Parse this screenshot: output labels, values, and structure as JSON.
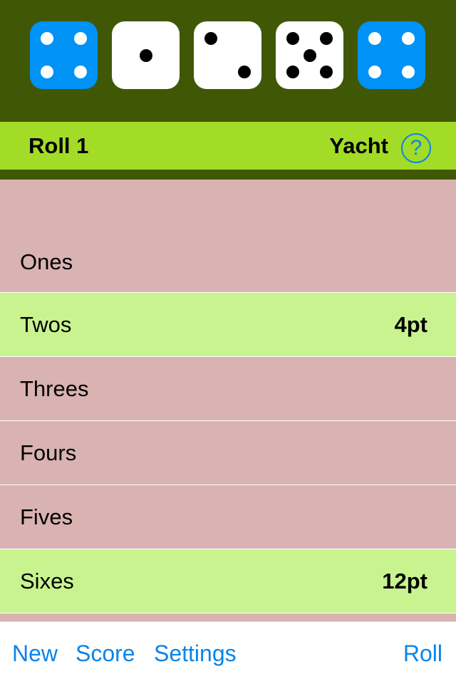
{
  "dice": [
    {
      "value": 4,
      "held": true
    },
    {
      "value": 1,
      "held": false
    },
    {
      "value": 2,
      "held": false
    },
    {
      "value": 5,
      "held": false
    },
    {
      "value": 4,
      "held": true
    }
  ],
  "status": {
    "roll_label": "Roll 1",
    "mode_label": "Yacht",
    "help_glyph": "?"
  },
  "categories": [
    {
      "name": "Ones",
      "value": ""
    },
    {
      "name": "Twos",
      "value": "4pt"
    },
    {
      "name": "Threes",
      "value": ""
    },
    {
      "name": "Fours",
      "value": ""
    },
    {
      "name": "Fives",
      "value": ""
    },
    {
      "name": "Sixes",
      "value": "12pt"
    }
  ],
  "toolbar": {
    "new_label": "New",
    "score_label": "Score",
    "settings_label": "Settings",
    "roll_label": "Roll"
  },
  "colors": {
    "header_bg": "#405806",
    "status_bg": "#a3dc27",
    "row_default": "#d8b3b2",
    "row_scored": "#c8f38f",
    "held_die": "#0092f5",
    "accent": "#0a84e8"
  },
  "icons": {
    "help": "question-circle-icon"
  }
}
